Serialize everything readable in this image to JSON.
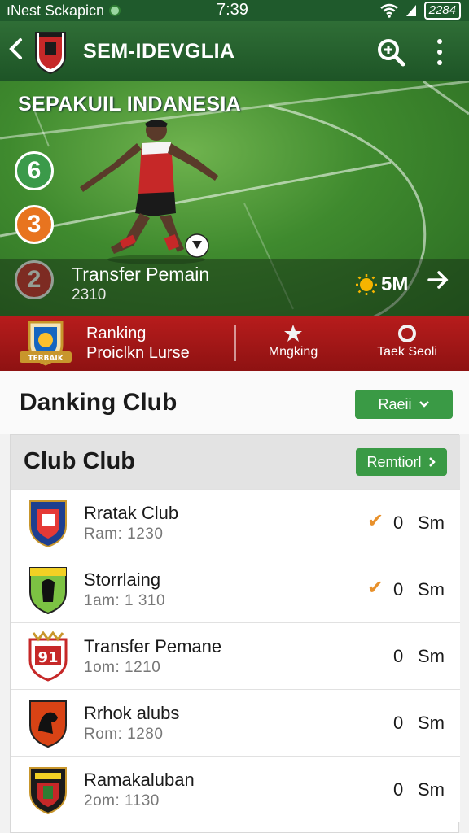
{
  "status_bar": {
    "carrier": "ıNest Sckapicn",
    "time": "7:39",
    "battery": "2284"
  },
  "app_bar": {
    "title": "SEM-IDEVGLIA"
  },
  "hero": {
    "league": "SEPAKUIL INDANESIA",
    "badges": [
      "6",
      "3",
      "2"
    ],
    "transfer_title": "Transfer Pemain",
    "transfer_sub": "2310",
    "amount": "5M",
    "colors": {
      "n1": "#3b9a4a",
      "n2": "#e8741f",
      "n3": "#d32f2f"
    }
  },
  "red_band": {
    "line1": "Ranking",
    "line2": "Proiclkn Lurse",
    "tab1": "Mngking",
    "tab2": "Taek Seoli",
    "badge_text": "TERBAIK"
  },
  "danking": {
    "title": "Danking Club",
    "button": "Raeii"
  },
  "club_section": {
    "title": "Club Club",
    "button": "Remtiorl",
    "rows": [
      {
        "name": "Rratak Club",
        "meta": "Ram:  1230",
        "checked": true,
        "value": "0",
        "unit": "Sm",
        "crest_color": "#1e3f8f"
      },
      {
        "name": "Storrlaing",
        "meta": "1am:  1 310",
        "checked": true,
        "value": "0",
        "unit": "Sm",
        "crest_color": "#7cc243"
      },
      {
        "name": "Transfer Pemane",
        "meta": "1om:  1210",
        "checked": false,
        "value": "0",
        "unit": "Sm",
        "crest_color": "#c62828",
        "crest_text": "91"
      },
      {
        "name": "Rrhok alubs",
        "meta": "Rom:  1280",
        "checked": false,
        "value": "0",
        "unit": "Sm",
        "crest_color": "#d84315"
      },
      {
        "name": "Ramakaluban",
        "meta": "2om:  1130",
        "checked": false,
        "value": "0",
        "unit": "Sm",
        "crest_color": "#1b1b1b"
      }
    ]
  },
  "accent_colors": {
    "green": "#3a9a45",
    "red": "#b71c1c",
    "check": "#e8912c"
  }
}
